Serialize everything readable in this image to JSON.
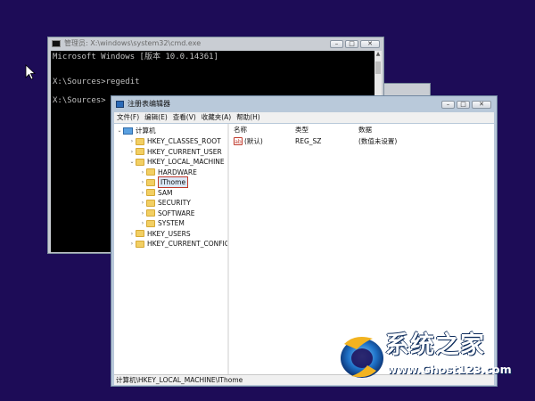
{
  "cmd": {
    "title": "管理员: X:\\windows\\system32\\cmd.exe",
    "lines": [
      "Microsoft Windows [版本 10.0.14361]",
      "",
      "X:\\Sources>regedit",
      "",
      "X:\\Sources>"
    ]
  },
  "controls": {
    "minimize": "–",
    "maximize": "□",
    "close": "✕"
  },
  "regedit": {
    "title": "注册表编辑器",
    "menu": [
      "文件(F)",
      "编辑(E)",
      "查看(V)",
      "收藏夹(A)",
      "帮助(H)"
    ],
    "tree": {
      "root": "计算机",
      "nodes": [
        {
          "label": "HKEY_CLASSES_ROOT",
          "arrow": "›"
        },
        {
          "label": "HKEY_CURRENT_USER",
          "arrow": "›"
        },
        {
          "label": "HKEY_LOCAL_MACHINE",
          "arrow": "⌄"
        },
        {
          "label": "HARDWARE",
          "arrow": "›"
        },
        {
          "label": "IThome",
          "arrow": "›"
        },
        {
          "label": "SAM",
          "arrow": "›"
        },
        {
          "label": "SECURITY",
          "arrow": "›"
        },
        {
          "label": "SOFTWARE",
          "arrow": "›"
        },
        {
          "label": "SYSTEM",
          "arrow": "›"
        },
        {
          "label": "HKEY_USERS",
          "arrow": "›"
        },
        {
          "label": "HKEY_CURRENT_CONFIG",
          "arrow": "›"
        }
      ],
      "root_arrow": "⌄"
    },
    "columns": {
      "name": "名称",
      "type": "类型",
      "data": "数据"
    },
    "row": {
      "name": "(默认)",
      "type": "REG_SZ",
      "data": "(数值未设置)",
      "icon_text": "ab"
    },
    "status": "计算机\\HKEY_LOCAL_MACHINE\\IThome"
  },
  "watermark": {
    "title": "系统之家",
    "url": "www.Ghost123.com"
  }
}
